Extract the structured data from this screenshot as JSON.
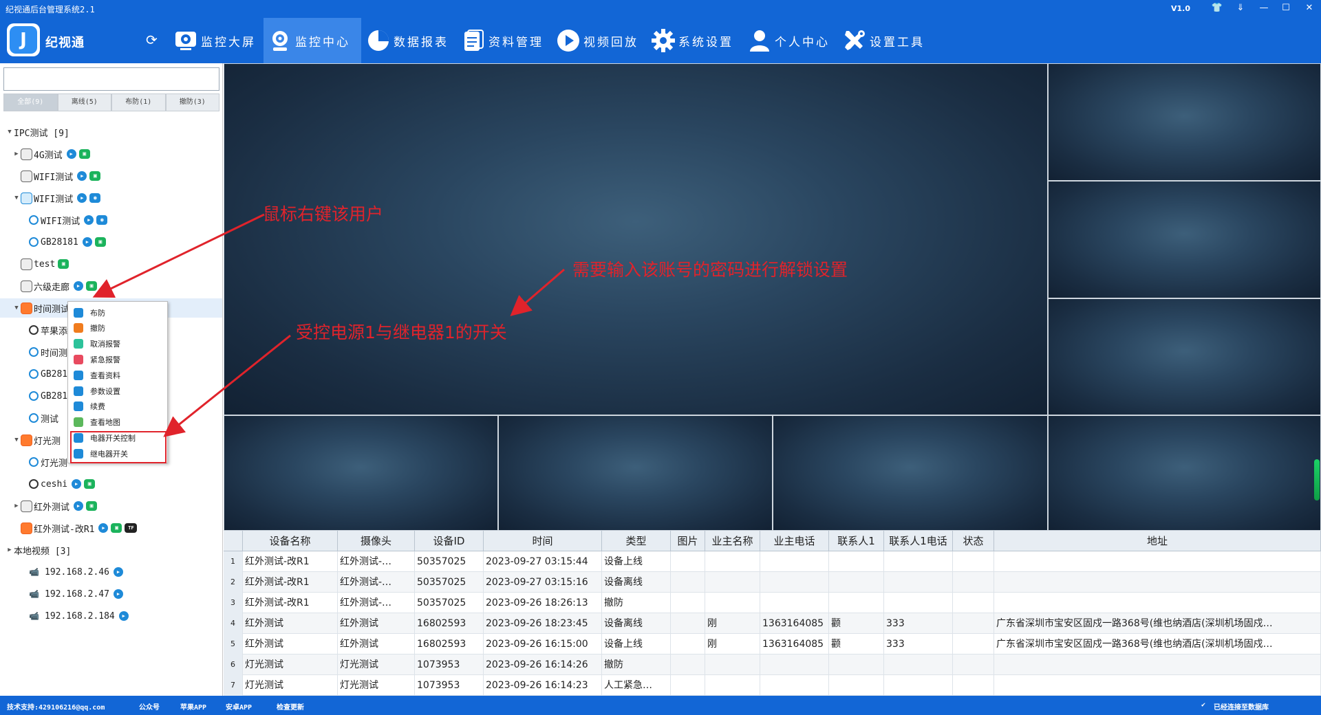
{
  "window": {
    "title": "纪视通后台管理系统2.1",
    "version": "V1.0",
    "controls": [
      "👕",
      "⇓",
      "—",
      "☐",
      "✕"
    ]
  },
  "header": {
    "brand": "纪视通",
    "nav": [
      {
        "label": "监控大屏",
        "icon": "monitor-icon"
      },
      {
        "label": "监控中心",
        "icon": "webcam-icon",
        "active": true
      },
      {
        "label": "数据报表",
        "icon": "pie-chart-icon"
      },
      {
        "label": "资料管理",
        "icon": "document-icon"
      },
      {
        "label": "视频回放",
        "icon": "play-icon"
      },
      {
        "label": "系统设置",
        "icon": "gear-icon"
      },
      {
        "label": "个人中心",
        "icon": "user-icon"
      },
      {
        "label": "设置工具",
        "icon": "tools-icon"
      }
    ]
  },
  "sidebar": {
    "search_placeholder": "",
    "filters": [
      "全部(9)",
      "离线(5)",
      "布防(1)",
      "撤防(3)"
    ],
    "tree": [
      {
        "label": "IPC测试 [9]",
        "arrow": "▼",
        "level": 0,
        "kind": "group"
      },
      {
        "label": "4G测试",
        "arrow": "▶",
        "level": 1,
        "kind": "device",
        "badges": [
          "play",
          "net"
        ]
      },
      {
        "label": "WIFI测试",
        "arrow": "",
        "level": 1,
        "kind": "device",
        "badges": [
          "play",
          "net"
        ]
      },
      {
        "label": "WIFI测试",
        "arrow": "▼",
        "level": 1,
        "kind": "device-wifi",
        "badges": [
          "play",
          "wifi"
        ]
      },
      {
        "label": "WIFI测试",
        "arrow": "",
        "level": 2,
        "kind": "cam",
        "badges": [
          "play",
          "wifi"
        ]
      },
      {
        "label": "GB28181",
        "arrow": "",
        "level": 2,
        "kind": "cam",
        "badges": [
          "play",
          "net"
        ]
      },
      {
        "label": "test",
        "arrow": "",
        "level": 1,
        "kind": "device",
        "badges": [
          "net"
        ]
      },
      {
        "label": "六级走廊",
        "arrow": "",
        "level": 1,
        "kind": "device",
        "badges": [
          "play",
          "net"
        ]
      },
      {
        "label": "时间测试H264",
        "arrow": "▼",
        "level": 1,
        "kind": "device-orange",
        "badges": [
          "play",
          "net"
        ],
        "selected": true
      },
      {
        "label": "苹果添",
        "arrow": "",
        "level": 2,
        "kind": "cam-dark",
        "badges": []
      },
      {
        "label": "时间测",
        "arrow": "",
        "level": 2,
        "kind": "cam",
        "badges": []
      },
      {
        "label": "GB2818",
        "arrow": "",
        "level": 2,
        "kind": "cam",
        "badges": []
      },
      {
        "label": "GB2818",
        "arrow": "",
        "level": 2,
        "kind": "cam",
        "badges": []
      },
      {
        "label": "测试",
        "arrow": "",
        "level": 2,
        "kind": "cam",
        "badges": []
      },
      {
        "label": "灯光测",
        "arrow": "▼",
        "level": 1,
        "kind": "device-orange",
        "badges": []
      },
      {
        "label": "灯光测",
        "arrow": "",
        "level": 2,
        "kind": "cam",
        "badges": []
      },
      {
        "label": "ceshi",
        "arrow": "",
        "level": 2,
        "kind": "cam-dark",
        "badges": [
          "play",
          "net"
        ]
      },
      {
        "label": "红外测试",
        "arrow": "▶",
        "level": 1,
        "kind": "device",
        "badges": [
          "play",
          "net"
        ]
      },
      {
        "label": "红外测试-改R1",
        "arrow": "",
        "level": 1,
        "kind": "device-orange",
        "badges": [
          "play",
          "net",
          "tf"
        ]
      },
      {
        "label": "本地视频 [3]",
        "arrow": "▶",
        "level": 0,
        "kind": "group"
      },
      {
        "label": "192.168.2.46",
        "arrow": "",
        "level": 2,
        "kind": "local",
        "badges": [
          "play"
        ]
      },
      {
        "label": "192.168.2.47",
        "arrow": "",
        "level": 2,
        "kind": "local",
        "badges": [
          "play"
        ]
      },
      {
        "label": "192.168.2.184",
        "arrow": "",
        "level": 2,
        "kind": "local",
        "badges": [
          "play"
        ]
      }
    ],
    "badge_text": {
      "play": "▶",
      "net": "▣",
      "wifi": "◉",
      "tf": "TF"
    }
  },
  "context_menu": {
    "items": [
      {
        "label": "布防",
        "color": "#1e8ad8"
      },
      {
        "label": "撤防",
        "color": "#f07c1e"
      },
      {
        "label": "取消报警",
        "color": "#2cc29a"
      },
      {
        "label": "紧急报警",
        "color": "#e84a5f"
      },
      {
        "label": "查看资料",
        "color": "#1e8ad8"
      },
      {
        "label": "参数设置",
        "color": "#1e8ad8"
      },
      {
        "label": "续费",
        "color": "#1e8ad8"
      },
      {
        "label": "查看地图",
        "color": "#5cb85c"
      },
      {
        "label": "电器开关控制",
        "color": "#1e8ad8"
      },
      {
        "label": "继电器开关",
        "color": "#1e8ad8"
      }
    ]
  },
  "annotations": [
    {
      "text": "鼠标右键该用户"
    },
    {
      "text": "需要输入该账号的密码进行解锁设置"
    },
    {
      "text": "受控电源1与继电器1的开关"
    }
  ],
  "colors": {
    "accent": "#1266d6",
    "annotation": "#e0232b"
  },
  "table": {
    "columns": [
      "",
      "设备名称",
      "摄像头",
      "设备ID",
      "时间",
      "类型",
      "图片",
      "业主名称",
      "业主电话",
      "联系人1",
      "联系人1电话",
      "状态",
      "地址"
    ],
    "rows": [
      [
        "1",
        "红外测试-改R1",
        "红外测试-…",
        "50357025",
        "2023-09-27 03:15:44",
        "设备上线",
        "",
        "",
        "",
        "",
        "",
        "",
        ""
      ],
      [
        "2",
        "红外测试-改R1",
        "红外测试-…",
        "50357025",
        "2023-09-27 03:15:16",
        "设备离线",
        "",
        "",
        "",
        "",
        "",
        "",
        ""
      ],
      [
        "3",
        "红外测试-改R1",
        "红外测试-…",
        "50357025",
        "2023-09-26 18:26:13",
        "撤防",
        "",
        "",
        "",
        "",
        "",
        "",
        ""
      ],
      [
        "4",
        "红外测试",
        "红外测试",
        "16802593",
        "2023-09-26 18:23:45",
        "设备离线",
        "",
        "刚",
        "1363164085",
        "颧",
        "333",
        "",
        "广东省深圳市宝安区固戍一路368号(维也纳酒店(深圳机场固戍…"
      ],
      [
        "5",
        "红外测试",
        "红外测试",
        "16802593",
        "2023-09-26 16:15:00",
        "设备上线",
        "",
        "刚",
        "1363164085",
        "颧",
        "333",
        "",
        "广东省深圳市宝安区固戍一路368号(维也纳酒店(深圳机场固戍…"
      ],
      [
        "6",
        "灯光测试",
        "灯光测试",
        "1073953",
        "2023-09-26 16:14:26",
        "撤防",
        "",
        "",
        "",
        "",
        "",
        "",
        ""
      ],
      [
        "7",
        "灯光测试",
        "灯光测试",
        "1073953",
        "2023-09-26 16:14:23",
        "人工紧急…",
        "",
        "",
        "",
        "",
        "",
        "",
        ""
      ]
    ]
  },
  "footer": {
    "support": "技术支持:429106216@qq.com",
    "links": [
      "公众号",
      "苹果APP",
      "安卓APP",
      "检查更新"
    ],
    "status": "已经连接至数据库"
  }
}
